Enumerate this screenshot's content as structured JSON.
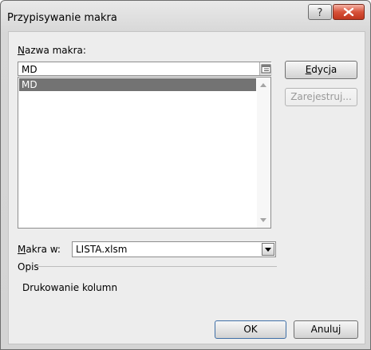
{
  "window": {
    "title": "Przypisywanie makra",
    "help_icon": "question-mark-icon",
    "close_icon": "close-x-icon"
  },
  "macro_name": {
    "label_underlined": "N",
    "label_rest": "azwa makra:",
    "value": "MD",
    "ref_icon": "range-collapse-icon"
  },
  "macro_list": {
    "items": [
      "MD"
    ],
    "selected_index": 0
  },
  "buttons": {
    "edit_underlined": "E",
    "edit_rest": "dycja",
    "record": "Zarejestruj...",
    "ok": "OK",
    "cancel": "Anuluj"
  },
  "macros_in": {
    "label_underlined": "M",
    "label_rest": "akra w:",
    "value": "LISTA.xlsm"
  },
  "description": {
    "label": "Opis",
    "text": "Drukowanie kolumn"
  }
}
